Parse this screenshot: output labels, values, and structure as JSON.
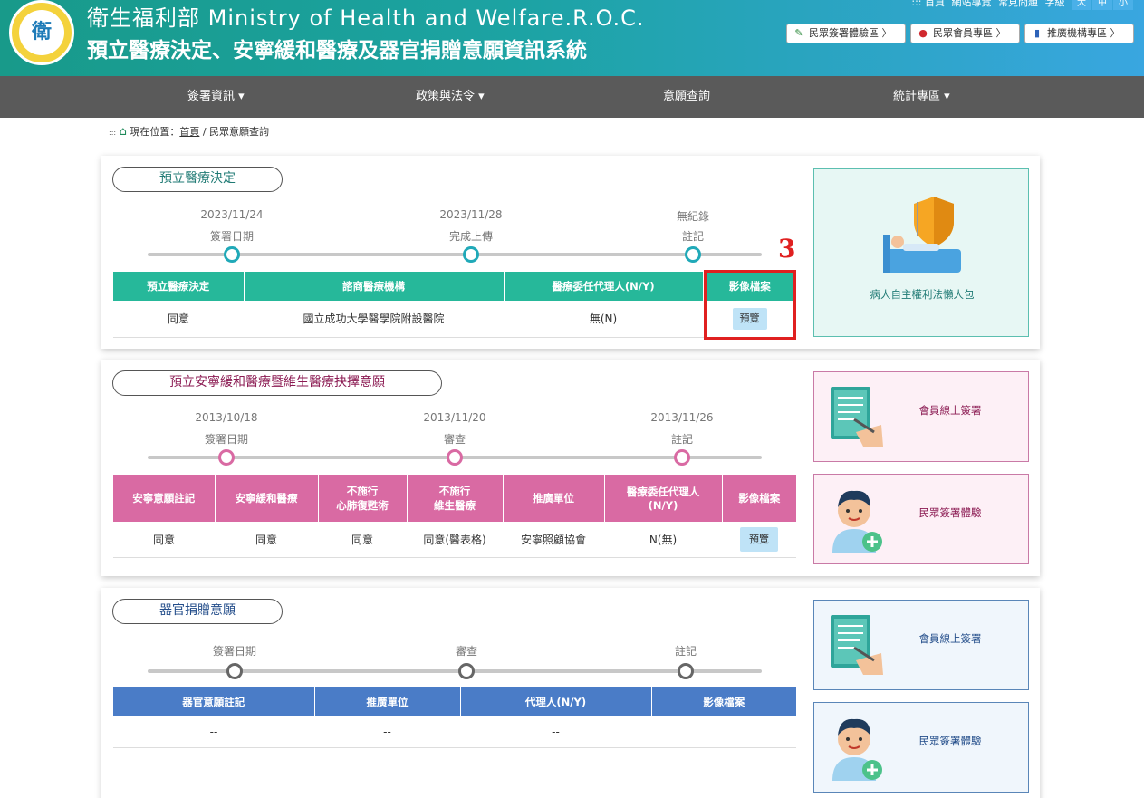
{
  "header": {
    "org": "衛生福利部 Ministry of Health and Welfare.R.O.C.",
    "system_title": "預立醫療決定、安寧緩和醫療及器官捐贈意願資訊系統",
    "logo_text": "衛",
    "top_links": [
      "::: 首頁",
      "網站導覽",
      "常見問題",
      "字級"
    ],
    "font_sizes": [
      "大",
      "中",
      "小"
    ],
    "buttons": [
      {
        "label": "民眾簽署體驗區 〉",
        "icon": "pencil-icon"
      },
      {
        "label": "民眾會員專區 〉",
        "icon": "user-icon"
      },
      {
        "label": "推廣機構專區 〉",
        "icon": "building-icon"
      }
    ]
  },
  "nav": {
    "items": [
      "簽署資訊 ▾",
      "政策與法令 ▾",
      "意願查詢",
      "統計專區 ▾"
    ]
  },
  "breadcrumb": {
    "prefix": ":::",
    "label": "現在位置：",
    "home": "首頁",
    "current": "/ 民眾意願查詢"
  },
  "sec1": {
    "title": "預立醫療決定",
    "timeline": [
      {
        "date": "2023/11/24",
        "label": "簽署日期"
      },
      {
        "date": "2023/11/28",
        "label": "完成上傳"
      },
      {
        "date": "無紀錄",
        "label": "註記"
      }
    ],
    "headers": [
      "預立醫療決定",
      "諮商醫療機構",
      "醫療委任代理人(N/Y)",
      "影像檔案"
    ],
    "row": [
      "同意",
      "國立成功大學醫學院附設醫院",
      "無(N)"
    ],
    "preview": "預覽",
    "annotation": "3",
    "color": "#26b89a"
  },
  "sec2": {
    "title": "預立安寧緩和醫療暨維生醫療抉擇意願",
    "timeline": [
      {
        "date": "2013/10/18",
        "label": "簽署日期"
      },
      {
        "date": "2013/11/20",
        "label": "審查"
      },
      {
        "date": "2013/11/26",
        "label": "註記"
      }
    ],
    "headers": [
      "安寧意願註記",
      "安寧緩和醫療",
      "不施行\n心肺復甦術",
      "不施行\n維生醫療",
      "推廣單位",
      "醫療委任代理人\n(N/Y)",
      "影像檔案"
    ],
    "row": [
      "同意",
      "同意",
      "同意",
      "同意(醫表格)",
      "安寧照顧協會",
      "N(無)"
    ],
    "preview": "預覽",
    "color": "#d96aa3"
  },
  "sec3": {
    "title": "器官捐贈意願",
    "timeline": [
      {
        "date": "",
        "label": "簽署日期"
      },
      {
        "date": "",
        "label": "審查"
      },
      {
        "date": "",
        "label": "註記"
      }
    ],
    "headers": [
      "器官意願註記",
      "推廣單位",
      "代理人(N/Y)",
      "影像檔案"
    ],
    "row": [
      "--",
      "--",
      "--",
      ""
    ],
    "color": "#4a7cc7"
  },
  "side": {
    "s1": "病人自主權利法懶人包",
    "s2a": "會員線上簽署",
    "s2b": "民眾簽署體驗",
    "s3a": "會員線上簽署",
    "s3b": "民眾簽署體驗"
  }
}
